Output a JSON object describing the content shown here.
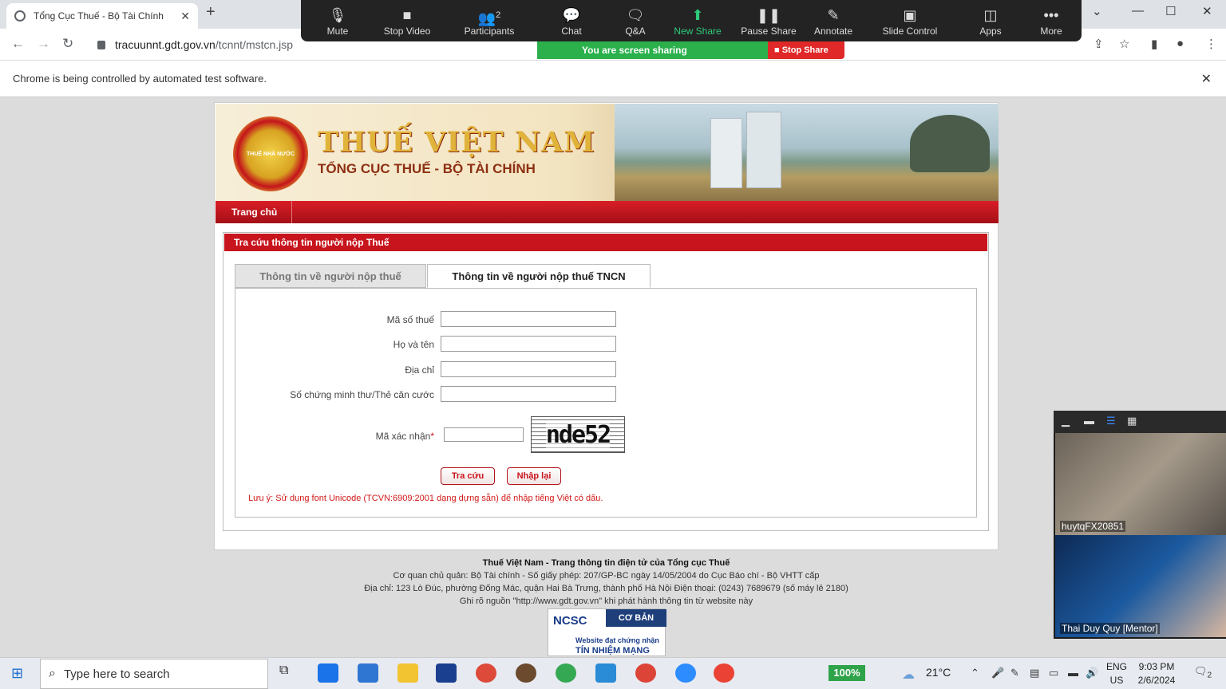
{
  "browser": {
    "tab_title": "Tổng Cục Thuế - Bộ Tài Chính",
    "url_host": "tracuunnt.gdt.gov.vn",
    "url_path": "/tcnnt/mstcn.jsp",
    "automation_notice": "Chrome is being controlled by automated test software."
  },
  "zoom": {
    "buttons": [
      "Mute",
      "Stop Video",
      "Participants",
      "Chat",
      "Q&A",
      "New Share",
      "Pause Share",
      "Annotate",
      "Slide Control",
      "Apps",
      "More"
    ],
    "participants_count": "2",
    "sharing_label": "You are screen sharing",
    "stop_share_label": "Stop Share",
    "video_names": [
      "huytqFX20851",
      "Thai Duy Quy [Mentor]"
    ]
  },
  "site": {
    "title": "THUẾ VIỆT NAM",
    "subtitle": "TỔNG CỤC THUẾ - BỘ TÀI CHÍNH",
    "emblem_text": "THUẾ NHÀ NƯỚC",
    "nav_home": "Trang chủ",
    "panel_title": "Tra cứu thông tin người nộp Thuế",
    "tabs": [
      "Thông tin về người nộp thuế",
      "Thông tin về người nộp thuế TNCN"
    ],
    "fields": {
      "tax_code": "Mã số thuế",
      "name": "Họ và tên",
      "address": "Địa chỉ",
      "id_card": "Số chứng minh thư/Thẻ căn cước",
      "captcha": "Mã xác nhận",
      "captcha_required": "*"
    },
    "captcha_text": "nde52",
    "buttons": {
      "search": "Tra cứu",
      "reset": "Nhập lại"
    },
    "note": "Lưu ý: Sử dụng font Unicode (TCVN:6909:2001 dạng dựng sẵn) để nhập tiếng Việt có dấu.",
    "footer": [
      "Thuế Việt Nam - Trang thông tin điện tử của Tổng cục Thuế",
      "Cơ quan chủ quản: Bộ Tài chính - Số giấy phép: 207/GP-BC ngày 14/05/2004 do Cục Báo chí - Bộ VHTT cấp",
      "Địa chỉ: 123 Lò Đúc, phường Đống Mác, quận Hai Bà Trưng, thành phố Hà Nội Điện thoại: (0243) 7689679 (số máy lẻ 2180)",
      "Ghi rõ nguồn \"http://www.gdt.gov.vn\" khi phát hành thông tin từ website này"
    ],
    "badge": {
      "logo": "NCSC",
      "level": "CƠ BẢN",
      "small": "Website đạt chứng nhận",
      "big": "TÍN NHIỆM MẠNG"
    }
  },
  "taskbar": {
    "search_placeholder": "Type here to search",
    "battery": "100%",
    "temperature": "21°C",
    "lang1": "ENG",
    "lang2": "US",
    "time": "9:03 PM",
    "date": "2/6/2024",
    "notifications": "2"
  }
}
